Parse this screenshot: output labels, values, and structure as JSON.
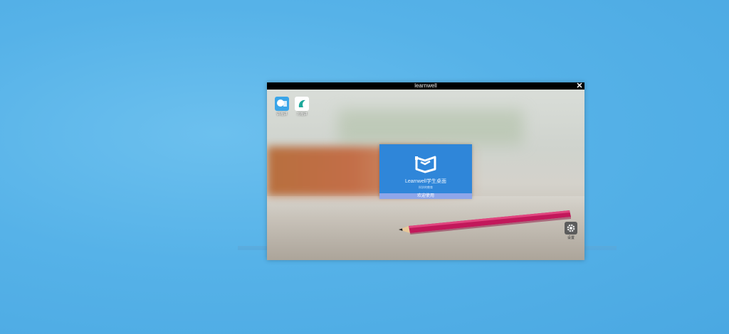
{
  "window": {
    "title": "learnwell",
    "close_glyph": "✕"
  },
  "desktop_icons": [
    {
      "label": "讲题讲",
      "icon": "learning-app-icon",
      "color": "#3aa5e8"
    },
    {
      "label": "习题讲",
      "icon": "exercise-app-icon",
      "color": "#ffffff"
    }
  ],
  "login_panel": {
    "brand": "Learnwell学生桌面",
    "subtitle": "科学的教育",
    "welcome_button": "欢迎使用",
    "logo_icon": "book-logo-icon",
    "color": "#2f86d9"
  },
  "settings": {
    "label": "设置",
    "icon": "gear-icon"
  }
}
